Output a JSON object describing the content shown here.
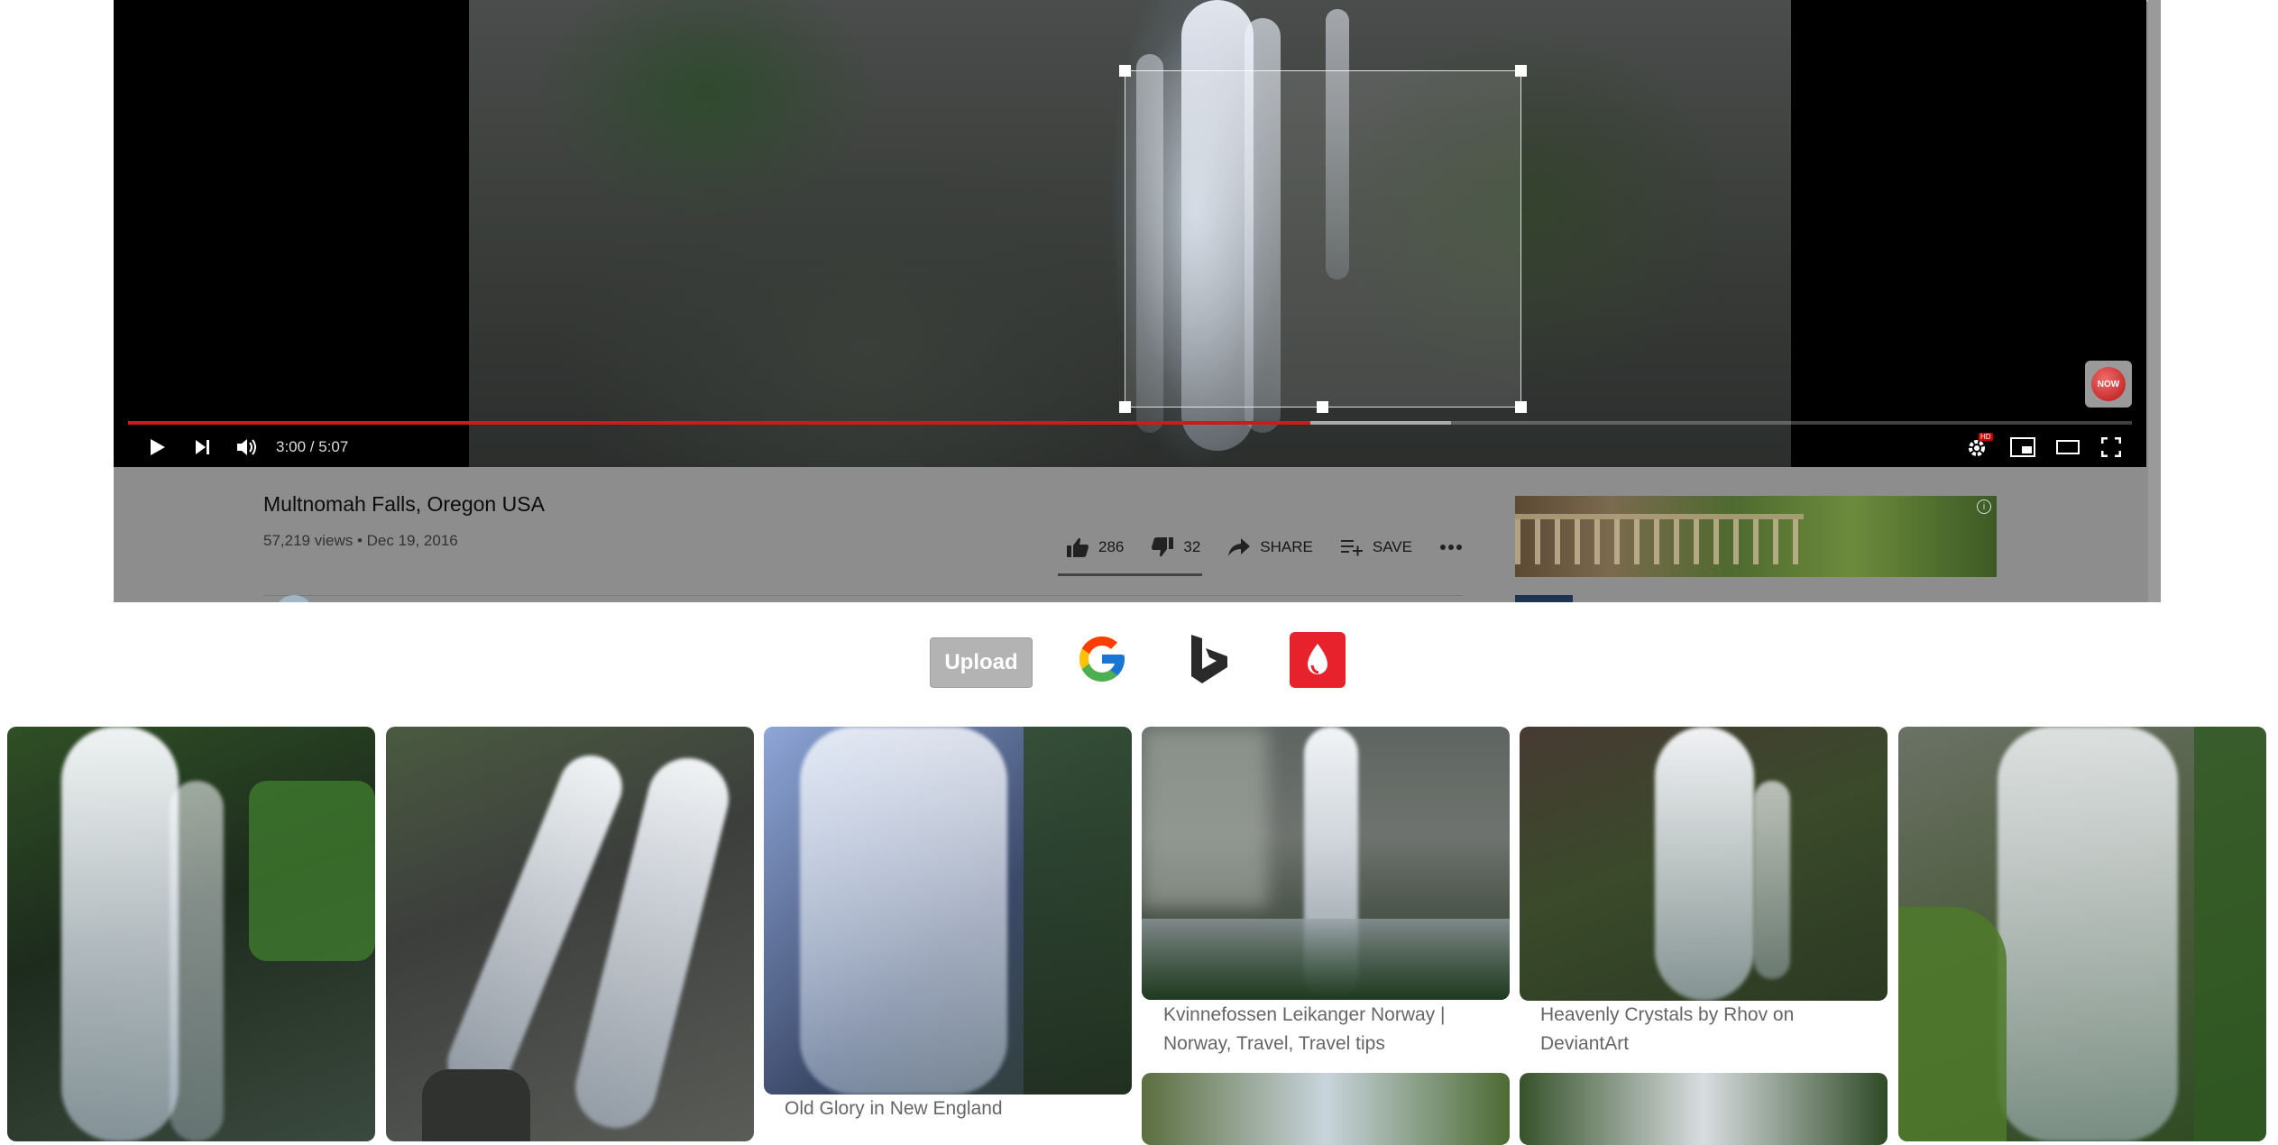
{
  "video": {
    "title": "Multnomah Falls, Oregon USA",
    "views_date": "57,219 views • Dec 19, 2016",
    "time": "3:00 / 5:07",
    "progress_fraction": 0.59,
    "buffered_fraction": 0.66,
    "now_badge": "NOW",
    "hd_badge": "HD"
  },
  "actions": {
    "likes": "286",
    "dislikes": "32",
    "share": "SHARE",
    "save": "SAVE"
  },
  "toolbar": {
    "upload": "Upload"
  },
  "results": [
    {
      "caption": ""
    },
    {
      "caption": ""
    },
    {
      "caption": "Old Glory in New England"
    },
    {
      "caption": "Kvinnefossen Leikanger Norway | Norway, Travel, Travel tips"
    },
    {
      "caption": "Heavenly Crystals by Rhov on DeviantArt"
    },
    {
      "caption": ""
    }
  ],
  "colors": {
    "progress": "#cc1b1b",
    "pinterest": "#e7222d",
    "upload_bg": "#b3b3b3"
  }
}
